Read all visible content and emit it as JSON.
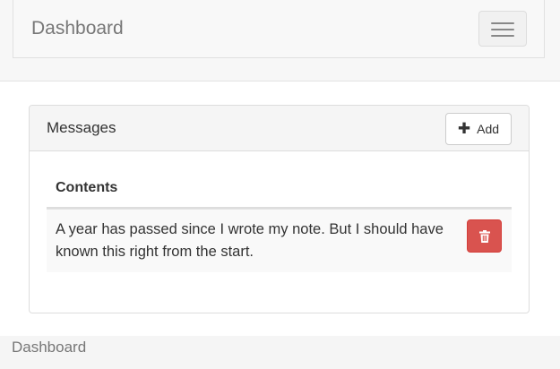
{
  "navbar": {
    "brand": "Dashboard",
    "toggle_icon": "hamburger-menu-icon"
  },
  "panel": {
    "title": "Messages",
    "add_button": {
      "icon": "plus-icon",
      "label": "Add"
    },
    "table": {
      "header": "Contents",
      "rows": [
        {
          "content": "A year has passed since I wrote my note. But I should have known this right from the start.",
          "delete_icon": "trash-icon"
        }
      ]
    }
  },
  "footer": {
    "text": "Dashboard"
  },
  "colors": {
    "danger": "#d9534f",
    "navbar_bg": "#f8f8f8",
    "muted_text": "#777777"
  }
}
